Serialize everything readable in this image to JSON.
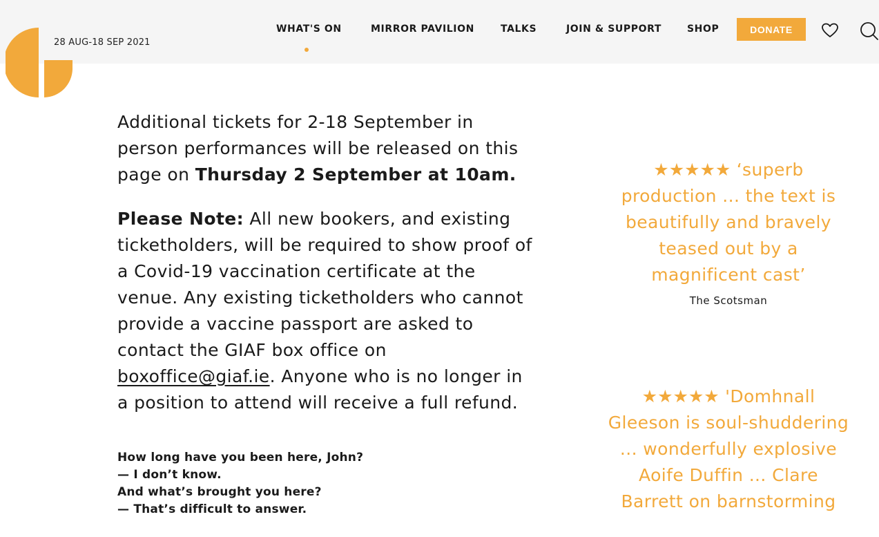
{
  "header": {
    "dates": "28 AUG-18 SEP 2021",
    "nav": [
      {
        "label": "WHAT'S ON",
        "active": true
      },
      {
        "label": "MIRROR PAVILION"
      },
      {
        "label": "TALKS"
      },
      {
        "label": "JOIN & SUPPORT"
      },
      {
        "label": "SHOP"
      }
    ],
    "donate_label": "DONATE",
    "icons": [
      "logo-icon",
      "heart-icon",
      "search-icon"
    ],
    "accent_color": "#f2a93b"
  },
  "main": {
    "p1_text": "Additional tickets for 2-18 September in person performances will be released on this page on ",
    "p1_bold": "Thursday 2 September at 10am.",
    "p2_label": "Please Note:",
    "p2_text": " All new bookers, and existing ticketholders, will be required to show proof of a Covid-19 vaccination certificate at the venue. Any existing ticketholders who cannot provide a vaccine passport are asked to contact the GIAF box office on ",
    "p2_link": "boxoffice@giaf.ie",
    "p2_tail": ". Anyone who is no longer in a position to attend will receive a full refund.",
    "dialog": [
      "How long have you been here, John?",
      "— I don’t know.",
      "And what’s brought you here?",
      "— That’s difficult to answer."
    ]
  },
  "reviews": [
    {
      "stars": "★★★★★",
      "quote": " ‘superb production ... the text is beautifully and bravely teased out by a magnificent cast’",
      "source": "The Scotsman"
    },
    {
      "stars": "★★★★★",
      "quote": " 'Domhnall Gleeson is soul-shuddering ... wonderfully explosive Aoife Duffin ... Clare Barrett on barnstorming"
    }
  ]
}
